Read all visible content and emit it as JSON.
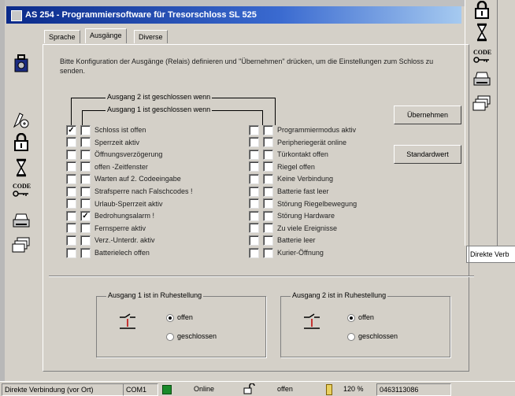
{
  "window": {
    "title": "AS 254 - Programmiersoftware für Tresorschloss SL 525"
  },
  "tabs": [
    {
      "label": "Sprache"
    },
    {
      "label": "Ausgänge"
    },
    {
      "label": "Diverse"
    }
  ],
  "active_tab": "Ausgänge",
  "instruction": "Bitte Konfiguration der Ausgänge (Relais) definieren und \"Übernehmen\" drücken, um die Einstellungen zum Schloss zu senden.",
  "brackets": {
    "ausgang2": "Ausgang 2 ist geschlossen wenn",
    "ausgang1": "Ausgang 1 ist geschlossen wenn"
  },
  "left_options": [
    {
      "label": "Schloss ist offen",
      "a1": false,
      "a2": true
    },
    {
      "label": "Sperrzeit aktiv",
      "a1": false,
      "a2": false
    },
    {
      "label": "Öffnungsverzögerung",
      "a1": false,
      "a2": false
    },
    {
      "label": "offen -Zeitfenster",
      "a1": false,
      "a2": false
    },
    {
      "label": "Warten auf 2. Codeeingabe",
      "a1": false,
      "a2": false
    },
    {
      "label": "Strafsperre nach Falschcodes !",
      "a1": false,
      "a2": false
    },
    {
      "label": "Urlaub-Sperrzeit aktiv",
      "a1": false,
      "a2": false
    },
    {
      "label": "Bedrohungsalarm !",
      "a1": true,
      "a2": false
    },
    {
      "label": "Fernsperre aktiv",
      "a1": false,
      "a2": false
    },
    {
      "label": "Verz.-Unterdr. aktiv",
      "a1": false,
      "a2": false
    },
    {
      "label": "Batterielech offen",
      "a1": false,
      "a2": false
    }
  ],
  "right_options": [
    {
      "label": "Programmiermodus aktiv",
      "a1": false,
      "a2": false
    },
    {
      "label": "Peripheriegerät online",
      "a1": false,
      "a2": false
    },
    {
      "label": "Türkontakt offen",
      "a1": false,
      "a2": false
    },
    {
      "label": "Riegel offen",
      "a1": false,
      "a2": false
    },
    {
      "label": "Keine Verbindung",
      "a1": false,
      "a2": false
    },
    {
      "label": "Batterie fast leer",
      "a1": false,
      "a2": false
    },
    {
      "label": "Störung Riegelbewegung",
      "a1": false,
      "a2": false
    },
    {
      "label": "Störung Hardware",
      "a1": false,
      "a2": false
    },
    {
      "label": "Zu viele Ereignisse",
      "a1": false,
      "a2": false
    },
    {
      "label": "Batterie leer",
      "a1": false,
      "a2": false
    },
    {
      "label": "Kurier-Öffnung",
      "a1": false,
      "a2": false
    }
  ],
  "buttons": {
    "apply": "Übernehmen",
    "default": "Standardwert"
  },
  "rest_groups": [
    {
      "title": "Ausgang 1 ist in Ruhestellung",
      "options": [
        "offen",
        "geschlossen"
      ],
      "selected": "offen"
    },
    {
      "title": "Ausgang 2 ist in Ruhestellung",
      "options": [
        "offen",
        "geschlossen"
      ],
      "selected": "offen"
    }
  ],
  "side_popup": "Direkte Verb",
  "statusbar": {
    "connection": "Direkte Verbindung (vor Ort)",
    "port": "COM1",
    "state": "Online",
    "lock": "offen",
    "battery": "120 %",
    "serial": "0463113086"
  },
  "left_toolbar_icons": [
    "lock-safe-icon",
    "key-person-icon",
    "padlock-icon",
    "hourglass-icon",
    "code-key-icon",
    "printer-icon",
    "stack-icon"
  ],
  "right_toolbar_icons": [
    "padlock-icon",
    "hourglass-icon",
    "code-key-icon",
    "printer-icon",
    "stack-icon"
  ]
}
